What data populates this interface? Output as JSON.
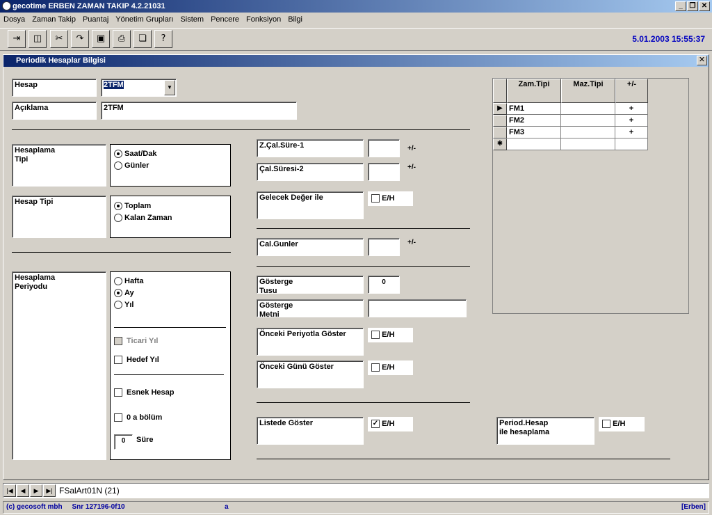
{
  "app": {
    "title": "gecotime  ERBEN ZAMAN TAKIP  4.2.21031",
    "datetime": "5.01.2003  15:55:37"
  },
  "menu": [
    "Dosya",
    "Zaman Takip",
    "Puantaj",
    "Yönetim Grupları",
    "Sistem",
    "Pencere",
    "Fonksiyon",
    "Bilgi"
  ],
  "window": {
    "title": "Periodik Hesaplar Bilgisi"
  },
  "form": {
    "hesap_label": "Hesap",
    "hesap_value": "2TFM",
    "aciklama_label": "Açıklama",
    "aciklama_value": "2TFM",
    "hesaplama_tipi_label": "Hesaplama\nTipi",
    "opt_saat": "Saat/Dak",
    "opt_gunler": "Günler",
    "hesap_tipi_label": "Hesap Tipi",
    "opt_toplam": "Toplam",
    "opt_kalan": "Kalan Zaman",
    "periyod_label": "Hesaplama\nPeriyodu",
    "opt_hafta": "Hafta",
    "opt_ay": "Ay",
    "opt_yil": "Yıl",
    "ticari_yil": "Ticari Yıl",
    "hedef_yil": "Hedef Yıl",
    "esnek_hesap": "Esnek Hesap",
    "a_bolum": "0 a bölüm",
    "sure_value": "0",
    "sure_label": "Süre",
    "zcal1": "Z.Çal.Süre-1",
    "zcal2": "Çal.Süresi-2",
    "pm": "+/-",
    "gelecek": "Gelecek Değer ile",
    "eh": "E/H",
    "calgunler": "Cal.Gunler",
    "gosterge_tusu": "Gösterge\nTusu",
    "gosterge_tusu_value": "0",
    "gosterge_metni": "Gösterge\nMetni",
    "onceki_periyot": "Önceki Periyotla Göster",
    "onceki_gun": "Önceki Günü Göster",
    "listede": "Listede Göster",
    "period_hesap": "Period.Hesap\nile hesaplama"
  },
  "grid": {
    "headers": [
      "Zam.Tipi",
      "Maz.Tipi",
      "+/-"
    ],
    "rows": [
      [
        "FM1",
        "",
        "+"
      ],
      [
        "FM2",
        "",
        "+"
      ],
      [
        "FM3",
        "",
        "+"
      ]
    ],
    "new_marker": "✱"
  },
  "nav": {
    "record": "FSalArt01N (21)"
  },
  "status": {
    "left": "(c) gecosoft mbh     Snr 127196-0f10",
    "middle": "a",
    "right": "[Erben]"
  }
}
